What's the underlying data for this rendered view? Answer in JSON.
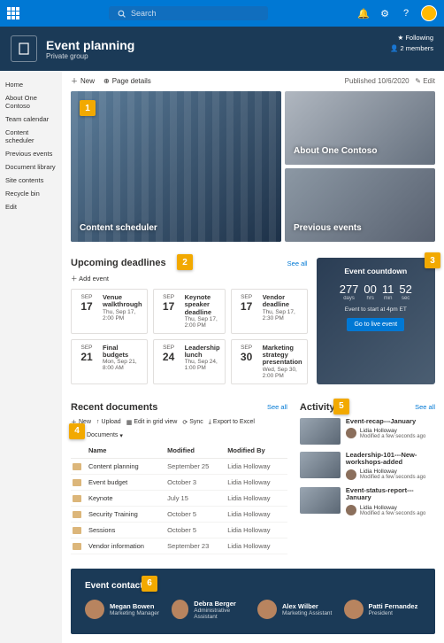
{
  "topbar": {
    "search_placeholder": "Search"
  },
  "site": {
    "title": "Event planning",
    "subtitle": "Private group",
    "following": "Following",
    "members": "2 members"
  },
  "leftnav": [
    "Home",
    "About One Contoso",
    "Team calendar",
    "Content scheduler",
    "Previous events",
    "Document library",
    "Site contents",
    "Recycle bin",
    "Edit"
  ],
  "cmd": {
    "new": "New",
    "details": "Page details",
    "published": "Published 10/6/2020",
    "edit": "Edit"
  },
  "hero": {
    "big": "Content scheduler",
    "r1": "About One Contoso",
    "r2": "Previous events"
  },
  "upcoming": {
    "title": "Upcoming deadlines",
    "add": "Add event",
    "seeall": "See all",
    "events": [
      {
        "mon": "SEP",
        "day": "17",
        "title": "Venue walkthrough",
        "time": "Thu, Sep 17, 2:00 PM"
      },
      {
        "mon": "SEP",
        "day": "17",
        "title": "Keynote speaker deadline",
        "time": "Thu, Sep 17, 2:00 PM"
      },
      {
        "mon": "SEP",
        "day": "17",
        "title": "Vendor deadline",
        "time": "Thu, Sep 17, 2:30 PM"
      },
      {
        "mon": "SEP",
        "day": "21",
        "title": "Final budgets",
        "time": "Mon, Sep 21, 8:00 AM"
      },
      {
        "mon": "SEP",
        "day": "24",
        "title": "Leadership lunch",
        "time": "Thu, Sep 24, 1:00 PM"
      },
      {
        "mon": "SEP",
        "day": "30",
        "title": "Marketing strategy presentation",
        "time": "Wed, Sep 30, 2:00 PM"
      }
    ]
  },
  "countdown": {
    "title": "Event countdown",
    "items": [
      {
        "val": "277",
        "unit": "days"
      },
      {
        "val": "00",
        "unit": "hrs"
      },
      {
        "val": "11",
        "unit": "min"
      },
      {
        "val": "52",
        "unit": "sec"
      }
    ],
    "sub": "Event to start at 4pm ET",
    "btn": "Go to live event"
  },
  "docs": {
    "title": "Recent documents",
    "seeall": "See all",
    "bar": [
      "New",
      "Upload",
      "Edit in grid view",
      "Sync",
      "Export to Excel",
      "All Documents"
    ],
    "cols": [
      "Name",
      "Modified",
      "Modified By"
    ],
    "rows": [
      {
        "name": "Content planning",
        "mod": "September 25",
        "by": "Lidia Holloway"
      },
      {
        "name": "Event budget",
        "mod": "October 3",
        "by": "Lidia Holloway"
      },
      {
        "name": "Keynote",
        "mod": "July 15",
        "by": "Lidia Holloway"
      },
      {
        "name": "Security Training",
        "mod": "October 5",
        "by": "Lidia Holloway"
      },
      {
        "name": "Sessions",
        "mod": "October 5",
        "by": "Lidia Holloway"
      },
      {
        "name": "Vendor information",
        "mod": "September 23",
        "by": "Lidia Holloway"
      }
    ]
  },
  "activity": {
    "title": "Activity",
    "seeall": "See all",
    "items": [
      {
        "title": "Event-recap---January",
        "auth": "Lidia Holloway",
        "sub": "Modified a few seconds ago"
      },
      {
        "title": "Leadership-101---New-workshops-added",
        "auth": "Lidia Holloway",
        "sub": "Modified a few seconds ago"
      },
      {
        "title": "Event-status-report---January",
        "auth": "Lidia Holloway",
        "sub": "Modified a few seconds ago"
      }
    ]
  },
  "contacts": {
    "title": "Event contacts",
    "people": [
      {
        "name": "Megan Bowen",
        "role": "Marketing Manager"
      },
      {
        "name": "Debra Berger",
        "role": "Administrative Assistant"
      },
      {
        "name": "Alex Wilber",
        "role": "Marketing Assistant"
      },
      {
        "name": "Patti Fernandez",
        "role": "President"
      }
    ]
  },
  "callouts": [
    "1",
    "2",
    "3",
    "4",
    "5",
    "6"
  ]
}
